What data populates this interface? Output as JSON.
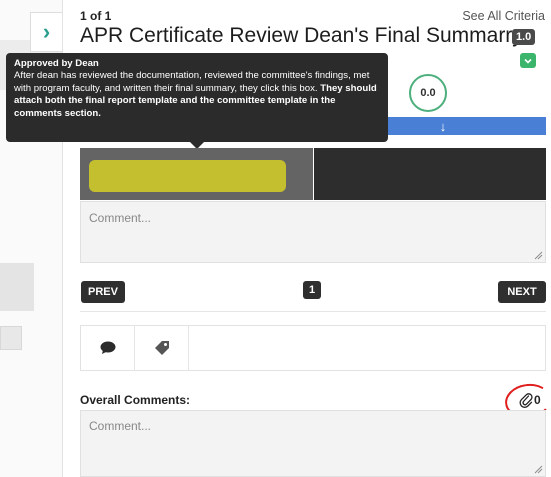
{
  "header": {
    "counter": "1 of 1",
    "see_all": "See All Criteria",
    "title": "APR Certificate Review Dean's Final Summarry",
    "version": "1.0"
  },
  "score": "0.0",
  "tooltip": {
    "title": "Approved by Dean",
    "body": "After dean has reviewed the documentation, reviewed the committee's findings, met with program faculty, and written their final summary, they click this box.",
    "emphasis": "They should attach both the final report template and the committee template in the comments section."
  },
  "comment": {
    "placeholder": "Comment..."
  },
  "pagination": {
    "prev": "PREV",
    "page": "1",
    "next": "NEXT"
  },
  "overall": {
    "label": "Overall Comments:",
    "attachment_count": "0",
    "placeholder": "Comment..."
  },
  "icons": {
    "expand": "chevron-right-icon",
    "collapse": "chevron-down-icon",
    "comment_tab": "speech-bubble-icon",
    "tag_tab": "tag-icon",
    "attach": "paperclip-icon",
    "blue_bar": "arrow-down-icon"
  },
  "colors": {
    "accent_green": "#3bb56b",
    "blue_bar": "#4a7fd6",
    "highlight": "#c9c42b",
    "annotation_red": "#e01e1e"
  }
}
